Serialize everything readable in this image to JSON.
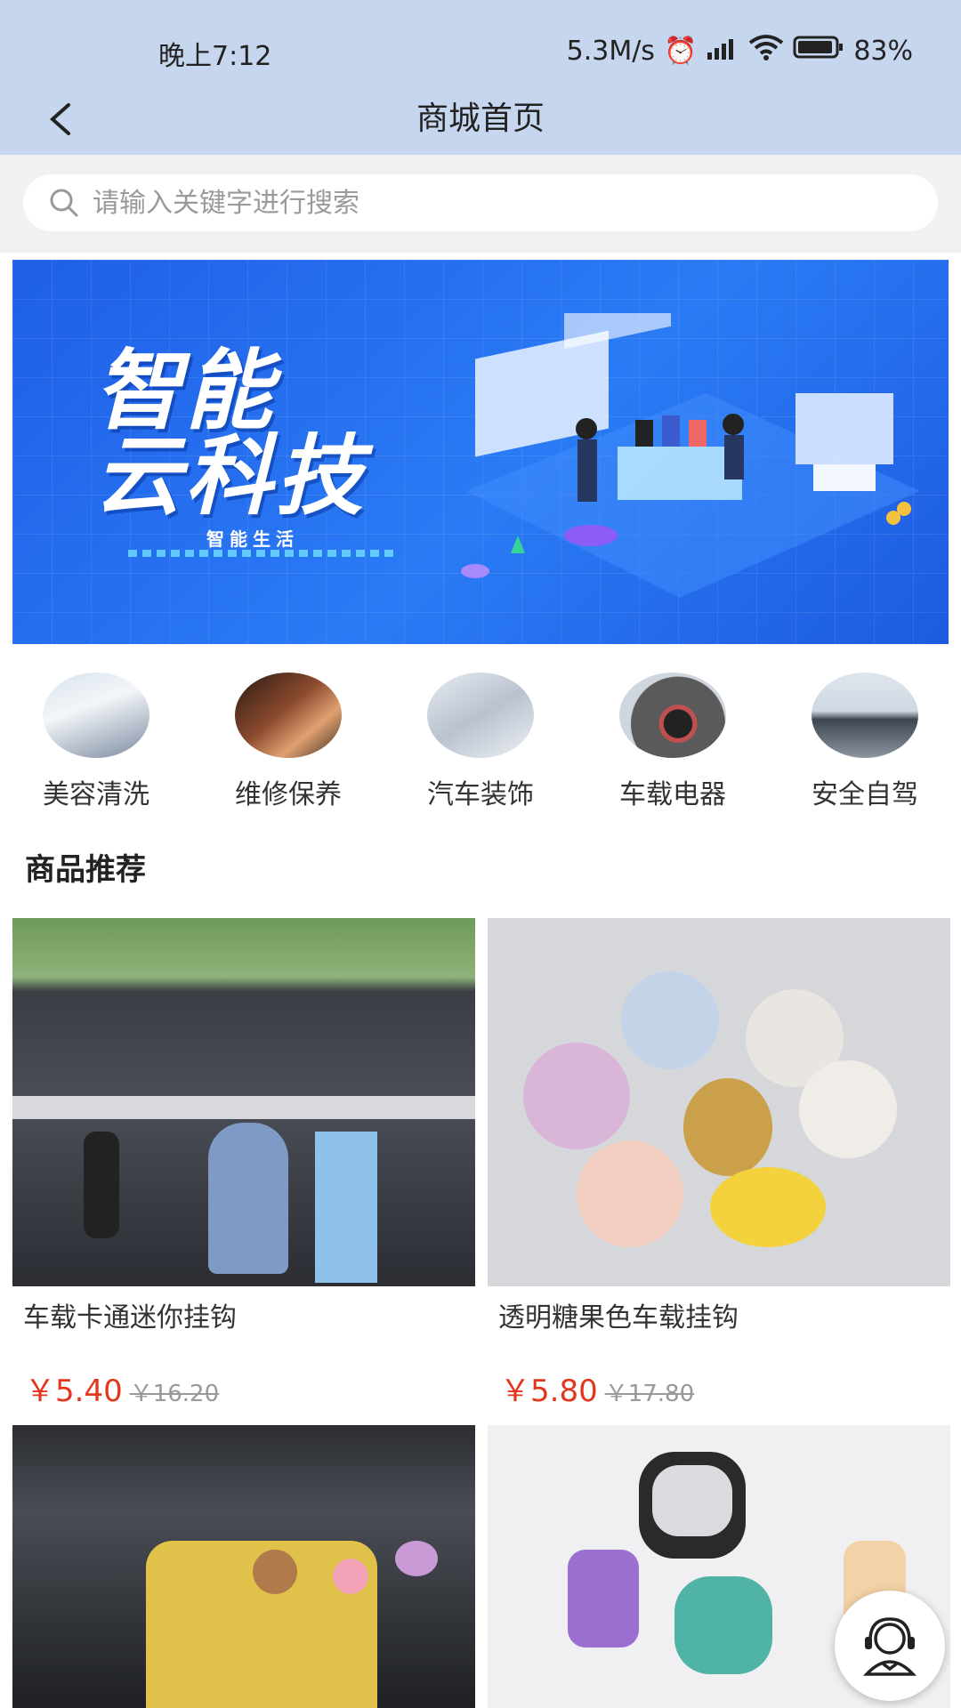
{
  "status": {
    "time": "晚上7:12",
    "net": "5.3M/s",
    "battery": "83%"
  },
  "header": {
    "title": "商城首页"
  },
  "search": {
    "placeholder": "请输入关键字进行搜索"
  },
  "banner": {
    "title_line1": "智能",
    "title_line2": "云科技",
    "subtitle": "智能生活"
  },
  "categories": [
    {
      "label": "美容清洗"
    },
    {
      "label": "维修保养"
    },
    {
      "label": "汽车装饰"
    },
    {
      "label": "车载电器"
    },
    {
      "label": "安全自驾"
    }
  ],
  "section": {
    "title": "商品推荐"
  },
  "products": [
    {
      "name": "车载卡通迷你挂钩",
      "price": "￥5.40",
      "old_price": "￥16.20"
    },
    {
      "name": "透明糖果色车载挂钩",
      "price": "￥5.80",
      "old_price": "￥17.80"
    },
    {
      "name": "",
      "price": "",
      "old_price": ""
    },
    {
      "name": "",
      "price": "",
      "old_price": ""
    }
  ],
  "colors": {
    "header_bg": "#c5d6ee",
    "price": "#e2361d",
    "banner": "#2a7bf5"
  }
}
